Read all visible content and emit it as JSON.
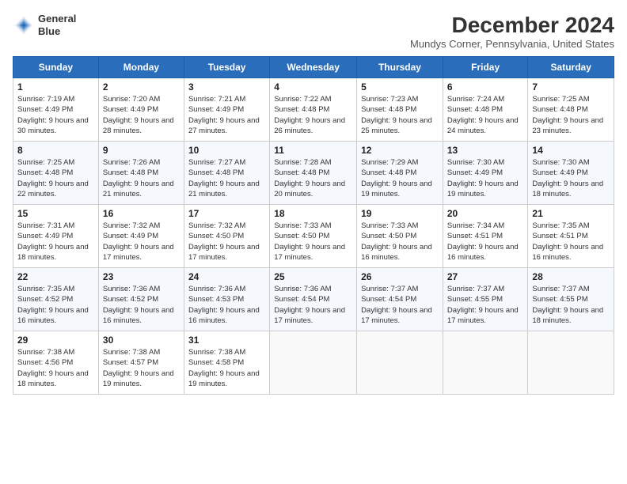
{
  "header": {
    "logo_line1": "General",
    "logo_line2": "Blue",
    "title": "December 2024",
    "subtitle": "Mundys Corner, Pennsylvania, United States"
  },
  "columns": [
    "Sunday",
    "Monday",
    "Tuesday",
    "Wednesday",
    "Thursday",
    "Friday",
    "Saturday"
  ],
  "weeks": [
    [
      {
        "day": "1",
        "sunrise": "7:19 AM",
        "sunset": "4:49 PM",
        "daylight": "9 hours and 30 minutes."
      },
      {
        "day": "2",
        "sunrise": "7:20 AM",
        "sunset": "4:49 PM",
        "daylight": "9 hours and 28 minutes."
      },
      {
        "day": "3",
        "sunrise": "7:21 AM",
        "sunset": "4:49 PM",
        "daylight": "9 hours and 27 minutes."
      },
      {
        "day": "4",
        "sunrise": "7:22 AM",
        "sunset": "4:48 PM",
        "daylight": "9 hours and 26 minutes."
      },
      {
        "day": "5",
        "sunrise": "7:23 AM",
        "sunset": "4:48 PM",
        "daylight": "9 hours and 25 minutes."
      },
      {
        "day": "6",
        "sunrise": "7:24 AM",
        "sunset": "4:48 PM",
        "daylight": "9 hours and 24 minutes."
      },
      {
        "day": "7",
        "sunrise": "7:25 AM",
        "sunset": "4:48 PM",
        "daylight": "9 hours and 23 minutes."
      }
    ],
    [
      {
        "day": "8",
        "sunrise": "7:25 AM",
        "sunset": "4:48 PM",
        "daylight": "9 hours and 22 minutes."
      },
      {
        "day": "9",
        "sunrise": "7:26 AM",
        "sunset": "4:48 PM",
        "daylight": "9 hours and 21 minutes."
      },
      {
        "day": "10",
        "sunrise": "7:27 AM",
        "sunset": "4:48 PM",
        "daylight": "9 hours and 21 minutes."
      },
      {
        "day": "11",
        "sunrise": "7:28 AM",
        "sunset": "4:48 PM",
        "daylight": "9 hours and 20 minutes."
      },
      {
        "day": "12",
        "sunrise": "7:29 AM",
        "sunset": "4:48 PM",
        "daylight": "9 hours and 19 minutes."
      },
      {
        "day": "13",
        "sunrise": "7:30 AM",
        "sunset": "4:49 PM",
        "daylight": "9 hours and 19 minutes."
      },
      {
        "day": "14",
        "sunrise": "7:30 AM",
        "sunset": "4:49 PM",
        "daylight": "9 hours and 18 minutes."
      }
    ],
    [
      {
        "day": "15",
        "sunrise": "7:31 AM",
        "sunset": "4:49 PM",
        "daylight": "9 hours and 18 minutes."
      },
      {
        "day": "16",
        "sunrise": "7:32 AM",
        "sunset": "4:49 PM",
        "daylight": "9 hours and 17 minutes."
      },
      {
        "day": "17",
        "sunrise": "7:32 AM",
        "sunset": "4:50 PM",
        "daylight": "9 hours and 17 minutes."
      },
      {
        "day": "18",
        "sunrise": "7:33 AM",
        "sunset": "4:50 PM",
        "daylight": "9 hours and 17 minutes."
      },
      {
        "day": "19",
        "sunrise": "7:33 AM",
        "sunset": "4:50 PM",
        "daylight": "9 hours and 16 minutes."
      },
      {
        "day": "20",
        "sunrise": "7:34 AM",
        "sunset": "4:51 PM",
        "daylight": "9 hours and 16 minutes."
      },
      {
        "day": "21",
        "sunrise": "7:35 AM",
        "sunset": "4:51 PM",
        "daylight": "9 hours and 16 minutes."
      }
    ],
    [
      {
        "day": "22",
        "sunrise": "7:35 AM",
        "sunset": "4:52 PM",
        "daylight": "9 hours and 16 minutes."
      },
      {
        "day": "23",
        "sunrise": "7:36 AM",
        "sunset": "4:52 PM",
        "daylight": "9 hours and 16 minutes."
      },
      {
        "day": "24",
        "sunrise": "7:36 AM",
        "sunset": "4:53 PM",
        "daylight": "9 hours and 16 minutes."
      },
      {
        "day": "25",
        "sunrise": "7:36 AM",
        "sunset": "4:54 PM",
        "daylight": "9 hours and 17 minutes."
      },
      {
        "day": "26",
        "sunrise": "7:37 AM",
        "sunset": "4:54 PM",
        "daylight": "9 hours and 17 minutes."
      },
      {
        "day": "27",
        "sunrise": "7:37 AM",
        "sunset": "4:55 PM",
        "daylight": "9 hours and 17 minutes."
      },
      {
        "day": "28",
        "sunrise": "7:37 AM",
        "sunset": "4:55 PM",
        "daylight": "9 hours and 18 minutes."
      }
    ],
    [
      {
        "day": "29",
        "sunrise": "7:38 AM",
        "sunset": "4:56 PM",
        "daylight": "9 hours and 18 minutes."
      },
      {
        "day": "30",
        "sunrise": "7:38 AM",
        "sunset": "4:57 PM",
        "daylight": "9 hours and 19 minutes."
      },
      {
        "day": "31",
        "sunrise": "7:38 AM",
        "sunset": "4:58 PM",
        "daylight": "9 hours and 19 minutes."
      },
      null,
      null,
      null,
      null
    ]
  ]
}
